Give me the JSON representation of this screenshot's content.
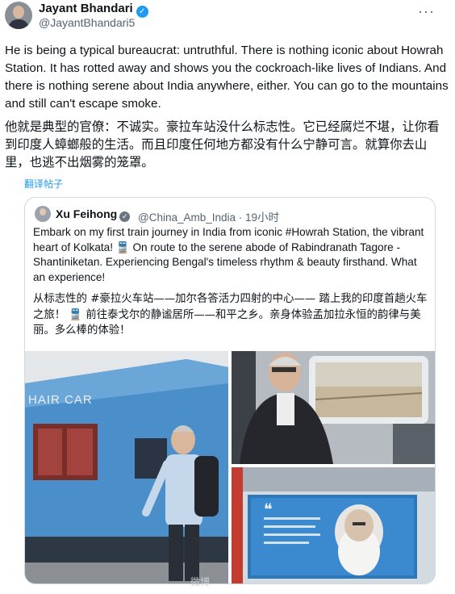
{
  "author": {
    "name": "Jayant Bhandari",
    "handle": "@JayantBhandari5",
    "verified_icon": "✓"
  },
  "more_icon": "···",
  "tweet": {
    "text_en": "He is being a typical bureaucrat: untruthful. There is nothing iconic about Howrah Station. It has rotted away and shows you the cockroach-like lives of Indians. And there is nothing serene about India anywhere, either. You can go to the mountains and still can't escape smoke.",
    "text_zh": "他就是典型的官僚：不诚实。豪拉车站没什么标志性。它已经腐烂不堪，让你看到印度人蟑螂般的生活。而且印度任何地方都没有什么宁静可言。就算你去山里，也逃不出烟雾的笼罩。",
    "translate_link": "翻译帖子"
  },
  "quoted": {
    "name": "Xu Feihong",
    "handle_time": "@China_Amb_India · 19小时",
    "text_en": "Embark on my first train journey in India from iconic #Howrah Station, the vibrant heart of Kolkata! 🚆 On route to the serene abode of Rabindranath Tagore - Shantiniketan. Experiencing Bengal's timeless rhythm & beauty firsthand. What an experience!",
    "text_zh": "从标志性的 #豪拉火车站——加尔各答活力四射的中心—— 踏上我的印度首趟火车之旅！ 🚆 前往泰戈尔的静谧居所——和平之乡。亲身体验孟加拉永恒的韵律与美丽。多么棒的体验！",
    "media": {
      "train_car_label": "HAIR CAR",
      "poster_quote_mark": "❝"
    }
  },
  "watermark": "微博"
}
